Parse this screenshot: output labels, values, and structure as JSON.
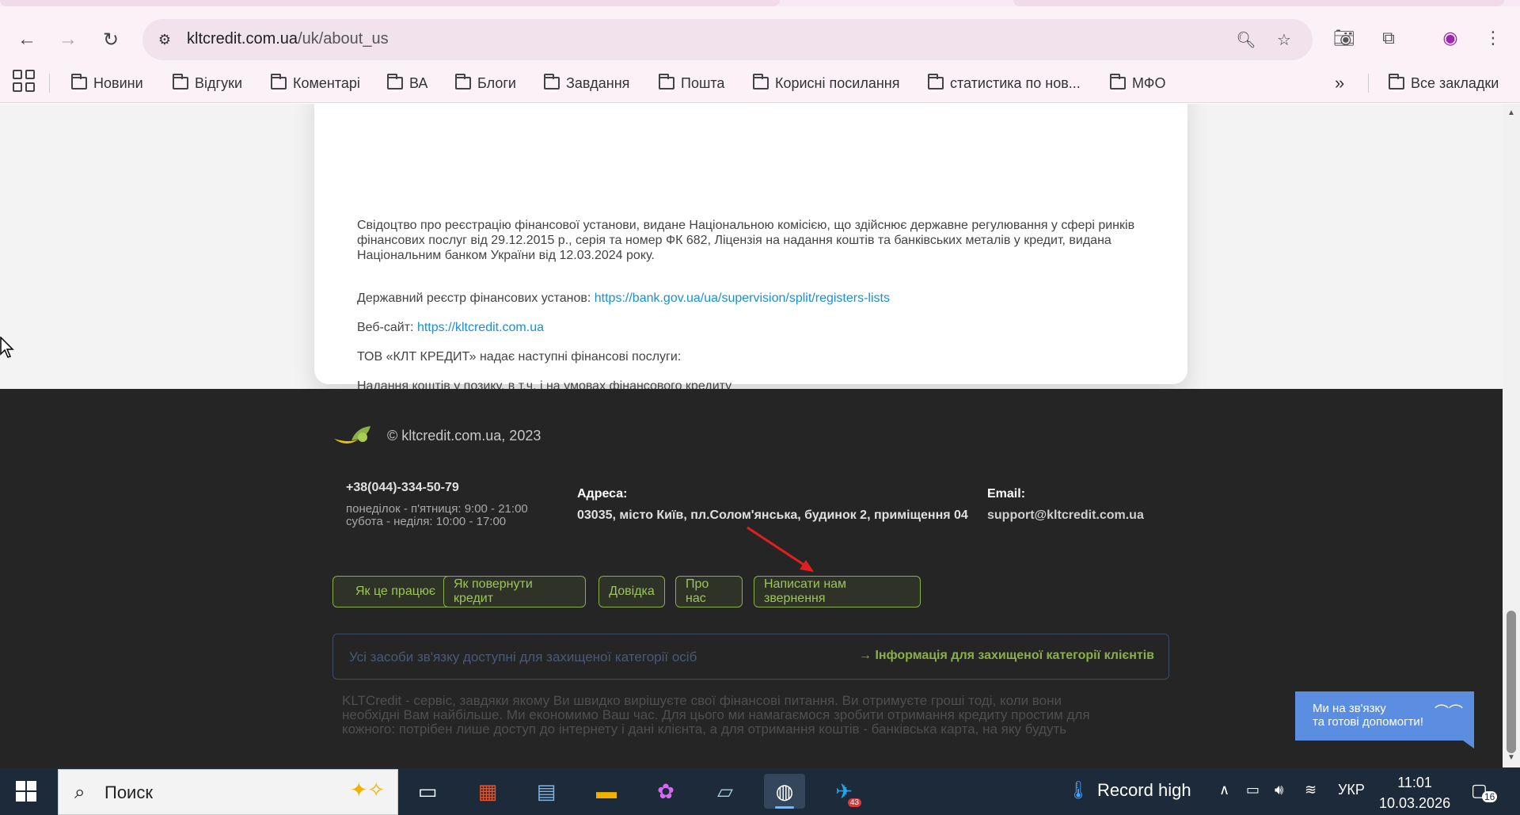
{
  "browser": {
    "url_host": "kltcredit.com.ua",
    "url_path": "/uk/about_us",
    "bookmarks": [
      {
        "label": "Новини"
      },
      {
        "label": "Відгуки"
      },
      {
        "label": "Коментарі"
      },
      {
        "label": "ВА"
      },
      {
        "label": "Блоги"
      },
      {
        "label": "Завдання"
      },
      {
        "label": "Пошта"
      },
      {
        "label": "Корисні посилання"
      },
      {
        "label": "статистика по нов..."
      },
      {
        "label": "МФО"
      }
    ],
    "overflow_label": "»",
    "all_bookmarks": "Все закладки"
  },
  "card": {
    "certificate_line1": "Свідоцтво про реєстрацію фінансової установи, видане Національною комісією, що здійснює державне регулювання у сфері ринків",
    "certificate_line2": "фінансових послуг від 29.12.2015 р., серія та номер ФК 682, Ліцензія на надання коштів та банківських металів у кредит, видана",
    "certificate_line3": "Національним банком України від 12.03.2024 року.",
    "registry_label": "Державний реєстр фінансових установ: ",
    "registry_link": "https://bank.gov.ua/ua/supervision/split/registers-lists",
    "website_label": "Веб-сайт: ",
    "website_link": "https://kltcredit.com.ua",
    "services_intro": "ТОВ «КЛТ КРЕДИТ» надає наступні фінансові послуги:",
    "service_item": "Надання коштів у позику, в т.ч. і на умовах фінансового кредиту"
  },
  "footer": {
    "copyright": "© kltcredit.com.ua, 2023",
    "phone": "+38(044)-334-50-79",
    "hours_weekdays": "понеділок - п'ятниця: 9:00 - 21:00",
    "hours_weekend": "субота - неділя: 10:00 - 17:00",
    "address_label": "Адреса:",
    "address_value": "03035, місто Київ, пл.Солом'янська, будинок 2, приміщення 04",
    "email_label": "Email:",
    "email_value": "support@kltcredit.com.ua",
    "buttons": [
      {
        "label": "Як це працює"
      },
      {
        "label": "Як повернути кредит"
      },
      {
        "label": "Довідка"
      },
      {
        "label": "Про нас"
      },
      {
        "label": "Написати нам звернення"
      }
    ],
    "protected_placeholder": "Усі засоби зв'язку доступні для захищеної категорії осіб",
    "protected_link": "→ Інформація для захищеної категорії клієнтів",
    "about_line1": "KLTCredit - сервіс, завдяки якому Ви швидко вирішуєте свої фінансові питання. Ви отримуєте гроші тоді, коли вони",
    "about_line2": "необхідні Вам найбільше. Ми економимо Ваш час. Для цього ми намагаємося зробити отримання кредиту простим для",
    "about_line3": "кожного: потрібен лише доступ до інтернету і дані клієнта, а для отримання коштів - банківська карта, на яку будуть"
  },
  "chat": {
    "line1": "Ми на зв'язку",
    "line2": "та готові допомогти!"
  },
  "taskbar": {
    "search_label": "Поиск",
    "weather_text": "Record high",
    "language": "УКР",
    "time": "11:01",
    "date": "10.03.2026",
    "telegram_badge": "43",
    "notifications_count": "16"
  },
  "colors": {
    "footer_bg": "#252525",
    "accent_green": "#8ab04a",
    "link_blue": "#1a8fd6",
    "chat_blue": "#5b8de0"
  }
}
